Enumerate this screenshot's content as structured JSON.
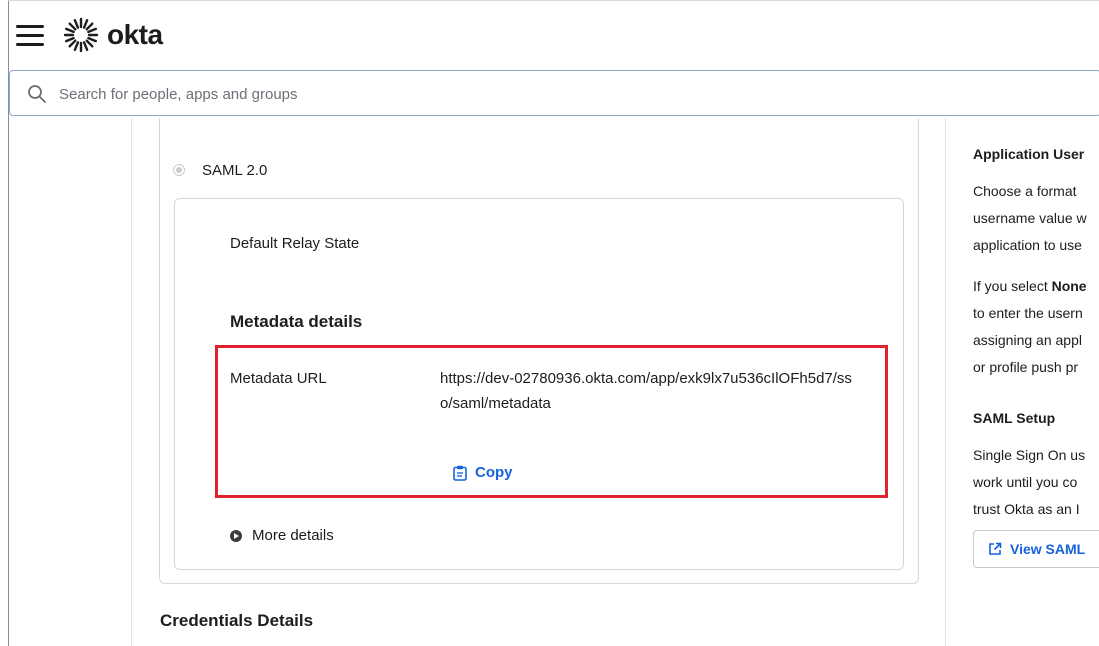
{
  "header": {
    "menu_icon": "hamburger-menu-icon",
    "logo_icon": "okta-sunburst-icon",
    "brand": "okta"
  },
  "search": {
    "icon": "search-icon",
    "placeholder": "Search for people, apps and groups",
    "value": ""
  },
  "saml": {
    "radio_label": "SAML 2.0",
    "radio_selected": true,
    "relay_state_label": "Default Relay State",
    "metadata_heading": "Metadata details",
    "metadata_url_label": "Metadata URL",
    "metadata_url": "https://dev-02780936.okta.com/app/exk9lx7u536cIlOFh5d7/sso/saml/metadata",
    "copy_label": "Copy",
    "copy_icon": "clipboard-icon",
    "more_details_label": "More details",
    "more_icon": "chevron-right-circle-icon",
    "highlight_color": "#e0222e"
  },
  "credentials": {
    "heading": "Credentials Details"
  },
  "sidebar": {
    "heading_user": "Application User",
    "para1": [
      "Choose a format",
      "username value w",
      "application to use"
    ],
    "para2_prefix": "If you select ",
    "para2_bold": "None",
    "para2_lines": [
      "to enter the usern",
      "assigning an appl",
      "or profile push pr"
    ],
    "heading_saml": "SAML Setup",
    "para3": [
      "Single Sign On us",
      "work until you co",
      "trust Okta as an I"
    ],
    "view_button": "View SAML",
    "view_icon": "external-link-icon"
  },
  "colors": {
    "accent": "#1662dd",
    "text": "#1d1d21",
    "border": "#d7d7dc"
  }
}
